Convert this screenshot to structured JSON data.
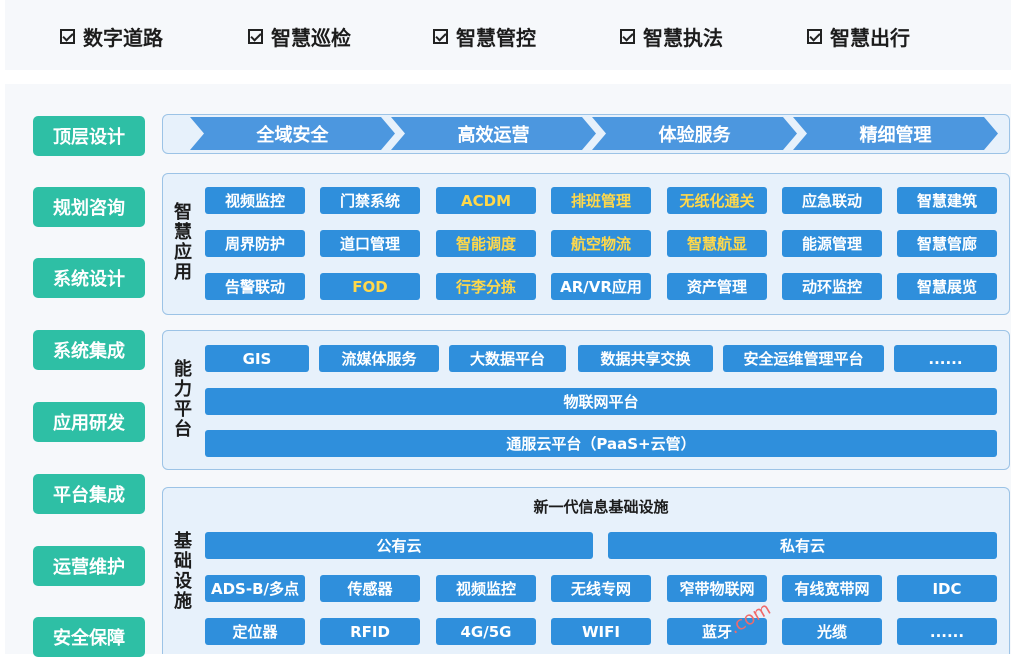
{
  "top_checks": [
    "数字道路",
    "智慧巡检",
    "智慧管控",
    "智慧执法",
    "智慧出行"
  ],
  "left_buttons": [
    "顶层设计",
    "规划咨询",
    "系统设计",
    "系统集成",
    "应用研发",
    "平台集成",
    "运营维护",
    "安全保障"
  ],
  "top_arrows": [
    "全域安全",
    "高效运营",
    "体验服务",
    "精细管理"
  ],
  "smart_app": {
    "label": [
      "智",
      "慧",
      "应",
      "用"
    ],
    "rows": [
      [
        {
          "t": "视频监控",
          "y": false
        },
        {
          "t": "门禁系统",
          "y": false
        },
        {
          "t": "ACDM",
          "y": true
        },
        {
          "t": "排班管理",
          "y": true
        },
        {
          "t": "无纸化通关",
          "y": true
        },
        {
          "t": "应急联动",
          "y": false
        },
        {
          "t": "智慧建筑",
          "y": false
        }
      ],
      [
        {
          "t": "周界防护",
          "y": false
        },
        {
          "t": "道口管理",
          "y": false
        },
        {
          "t": "智能调度",
          "y": true
        },
        {
          "t": "航空物流",
          "y": true
        },
        {
          "t": "智慧航显",
          "y": true
        },
        {
          "t": "能源管理",
          "y": false
        },
        {
          "t": "智慧管廊",
          "y": false
        }
      ],
      [
        {
          "t": "告警联动",
          "y": false
        },
        {
          "t": "FOD",
          "y": true
        },
        {
          "t": "行李分拣",
          "y": true
        },
        {
          "t": "AR/VR应用",
          "y": false
        },
        {
          "t": "资产管理",
          "y": false
        },
        {
          "t": "动环监控",
          "y": false
        },
        {
          "t": "智慧展览",
          "y": false
        }
      ]
    ]
  },
  "capability": {
    "label": [
      "能",
      "力",
      "平",
      "台"
    ],
    "chips": [
      "GIS",
      "流媒体服务",
      "大数据平台",
      "数据共享交换",
      "安全运维管理平台",
      "......"
    ],
    "iot": "物联网平台",
    "cloud": "通服云平台（PaaS+云管）"
  },
  "infra": {
    "label": [
      "基",
      "础",
      "设",
      "施"
    ],
    "title": "新一代信息基础设施",
    "public_cloud": "公有云",
    "private_cloud": "私有云",
    "row1": [
      "ADS-B/多点",
      "传感器",
      "视频监控",
      "无线专网",
      "窄带物联网",
      "有线宽带网",
      "IDC"
    ],
    "row2": [
      "定位器",
      "RFID",
      "4G/5G",
      "WIFI",
      "蓝牙",
      "光缆",
      "......"
    ]
  },
  "colors": {
    "teal": "#2ebfa5",
    "blue": "#2f8fdc",
    "yellow_text": "#ffd84a",
    "panel": "#e7f1fb"
  }
}
